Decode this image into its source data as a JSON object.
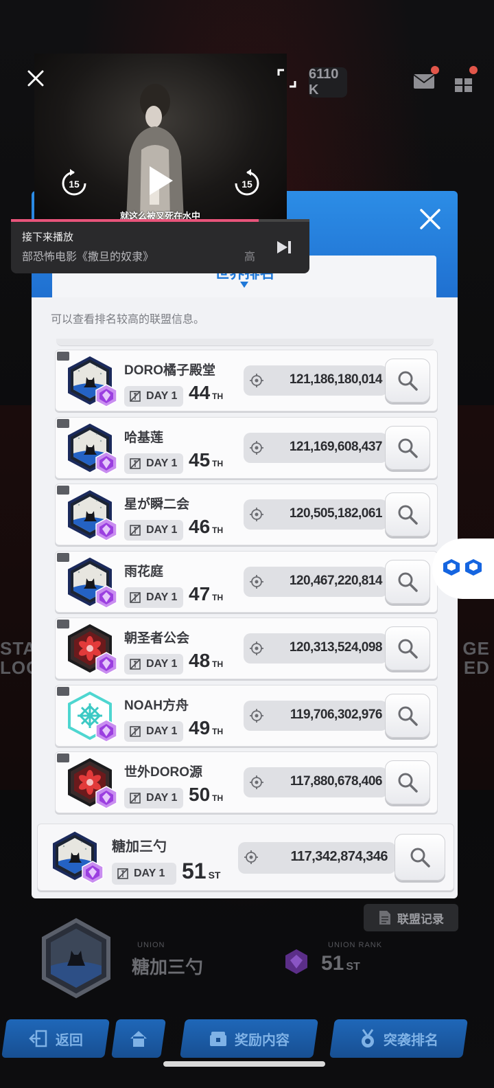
{
  "hud": {
    "currency": "6110 K"
  },
  "background": {
    "left_text": "STA\nLOC",
    "right_text": "GE\nED"
  },
  "panel": {
    "tab_title": "世界排名",
    "description": "可以查看排名较高的联盟信息。"
  },
  "rows": [
    {
      "name": "DORO橘子殿堂",
      "day": "DAY 1",
      "rank": "44",
      "suffix": "TH",
      "score": "121,186,180,014",
      "emblem": "cat-blue"
    },
    {
      "name": "哈基莲",
      "day": "DAY 1",
      "rank": "45",
      "suffix": "TH",
      "score": "121,169,608,437",
      "emblem": "cat-blue"
    },
    {
      "name": "星が瞬二会",
      "day": "DAY 1",
      "rank": "46",
      "suffix": "TH",
      "score": "120,505,182,061",
      "emblem": "cat-blue"
    },
    {
      "name": "雨花庭",
      "day": "DAY 1",
      "rank": "47",
      "suffix": "TH",
      "score": "120,467,220,814",
      "emblem": "cat-blue"
    },
    {
      "name": "朝圣者公会",
      "day": "DAY 1",
      "rank": "48",
      "suffix": "TH",
      "score": "120,313,524,098",
      "emblem": "flower-red"
    },
    {
      "name": "NOAH方舟",
      "day": "DAY 1",
      "rank": "49",
      "suffix": "TH",
      "score": "119,706,302,976",
      "emblem": "knot-cyan"
    },
    {
      "name": "世外DORO源",
      "day": "DAY 1",
      "rank": "50",
      "suffix": "TH",
      "score": "117,880,678,406",
      "emblem": "flower-red"
    }
  ],
  "my_row": {
    "name": "糖加三勺",
    "day": "DAY 1",
    "rank": "51",
    "suffix": "ST",
    "score": "117,342,874,346",
    "emblem": "cat-blue"
  },
  "union_record": {
    "label": "联盟记录"
  },
  "union_info": {
    "union_label": "UNION",
    "union_name": "糖加三勺",
    "rank_label": "UNION RANK",
    "rank_value": "51",
    "rank_suffix": "ST"
  },
  "bottom_nav": {
    "back": "返回",
    "rewards": "奖励内容",
    "raid_rank": "突袭排名"
  },
  "video": {
    "subtitle": "就这么被叉死在水中",
    "skip_back": "15",
    "skip_forward": "15",
    "progress_percent": 83,
    "up_next_label": "接下来播放",
    "up_next_title": "部恐怖电影《撒旦的奴隶》",
    "up_next_extra": "高"
  },
  "colors": {
    "panel_blue": "#2c8de6",
    "gem_purple": "#9b3fe0",
    "progress": "#e8547a"
  }
}
